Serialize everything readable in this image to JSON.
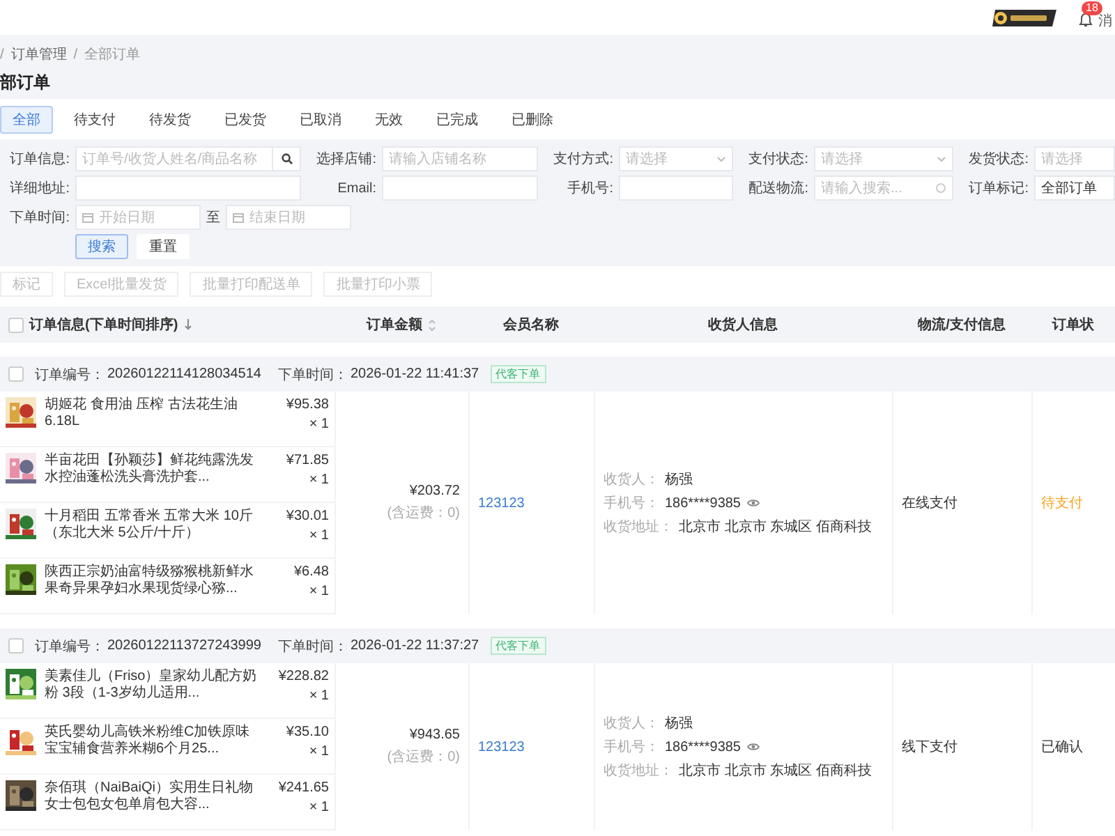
{
  "topbar": {
    "notification_count": "18",
    "notification_label": "消"
  },
  "breadcrumb": {
    "separator": "/",
    "items": [
      "订单管理",
      "全部订单"
    ]
  },
  "page_title": "部订单",
  "tabs": [
    {
      "label": "全部",
      "selected": true
    },
    {
      "label": "待支付",
      "selected": false
    },
    {
      "label": "待发货",
      "selected": false
    },
    {
      "label": "已发货",
      "selected": false
    },
    {
      "label": "已取消",
      "selected": false
    },
    {
      "label": "无效",
      "selected": false
    },
    {
      "label": "已完成",
      "selected": false
    },
    {
      "label": "已删除",
      "selected": false
    }
  ],
  "filter_rows": [
    [
      {
        "label": "订单信息:",
        "kind": "search",
        "placeholder": "订单号/收货人姓名/商品名称"
      },
      {
        "label": "选择店铺:",
        "kind": "text",
        "placeholder": "请输入店铺名称"
      },
      {
        "label": "支付方式:",
        "kind": "select",
        "placeholder": "请选择"
      },
      {
        "label": "支付状态:",
        "kind": "select",
        "placeholder": "请选择"
      },
      {
        "label": "发货状态:",
        "kind": "text",
        "placeholder": "请选择"
      }
    ],
    [
      {
        "label": "详细地址:",
        "kind": "text"
      },
      {
        "label": "Email:",
        "kind": "text"
      },
      {
        "label": "手机号:",
        "kind": "text"
      },
      {
        "label": "配送物流:",
        "kind": "lookup",
        "placeholder": "请输入搜索..."
      },
      {
        "label": "订单标记:",
        "kind": "text",
        "value": "全部订单"
      }
    ],
    [
      {
        "label": "下单时间:",
        "kind": "daterange",
        "start_placeholder": "开始日期",
        "separator": "至",
        "end_placeholder": "结束日期"
      }
    ]
  ],
  "filter_buttons": [
    {
      "label": "搜索",
      "kind": "primary"
    },
    {
      "label": "重置",
      "kind": "default"
    }
  ],
  "actions": [
    {
      "label": "标记",
      "disabled": true
    },
    {
      "label": "Excel批量发货",
      "disabled": true
    },
    {
      "label": "批量打印配送单",
      "disabled": true
    },
    {
      "label": "批量打印小票",
      "disabled": true
    }
  ],
  "table": {
    "select_all": {
      "checked": false
    },
    "columns": [
      {
        "label": "订单信息(下单时间排序)",
        "kind": "sorted"
      },
      {
        "label": "订单金额",
        "kind": "sortable"
      },
      {
        "label": "会员名称",
        "kind": "plain"
      },
      {
        "label": "收货人信息",
        "kind": "plain"
      },
      {
        "label": "物流/支付信息",
        "kind": "plain"
      },
      {
        "label": "订单状",
        "kind": "plain"
      }
    ]
  },
  "orders": [
    {
      "checked": false,
      "number_label": "订单编号：",
      "number": "20260122114128034514",
      "time_label": "下单时间：",
      "time": "2026-01-22 11:41:37",
      "tag": "代客下单",
      "items": [
        {
          "name": "胡姬花 食用油 压榨 古法花生油6.18L",
          "price": "¥95.38",
          "qty": "× 1"
        },
        {
          "name": "半亩花田【孙颖莎】鲜花纯露洗发水控油蓬松洗头膏洗护套...",
          "price": "¥71.85",
          "qty": "× 1"
        },
        {
          "name": "十月稻田 五常香米 五常大米 10斤（东北大米 5公斤/十斤）",
          "price": "¥30.01",
          "qty": "× 1"
        },
        {
          "name": "陕西正宗奶油富特级猕猴桃新鲜水果奇异果孕妇水果现货绿心猕...",
          "price": "¥6.48",
          "qty": "× 1"
        }
      ],
      "total": "¥203.72",
      "shipping": "(含运费：0)",
      "member": "123123",
      "receiver": {
        "name_label": "收货人：",
        "name": "杨强",
        "phone_label": "手机号：",
        "phone": "186****9385",
        "address_label": "收货地址：",
        "address": "北京市 北京市 东城区 佰商科技"
      },
      "payment": "在线支付",
      "status": {
        "label": "待支付",
        "color": "#f5a623"
      }
    },
    {
      "checked": false,
      "number_label": "订单编号：",
      "number": "20260122113727243999",
      "time_label": "下单时间：",
      "time": "2026-01-22 11:37:27",
      "tag": "代客下单",
      "items": [
        {
          "name": "美素佳儿（Friso）皇家幼儿配方奶粉 3段（1-3岁幼儿适用...",
          "price": "¥228.82",
          "qty": "× 1"
        },
        {
          "name": "英氏婴幼儿高铁米粉维C加铁原味宝宝辅食营养米糊6个月25...",
          "price": "¥35.10",
          "qty": "× 1"
        },
        {
          "name": "奈佰琪（NaiBaiQi）实用生日礼物女士包包女包单肩包大容...",
          "price": "¥241.65",
          "qty": "× 1"
        }
      ],
      "total": "¥943.65",
      "shipping": "(含运费：0)",
      "member": "123123",
      "receiver": {
        "name_label": "收货人：",
        "name": "杨强",
        "phone_label": "手机号：",
        "phone": "186****9385",
        "address_label": "收货地址：",
        "address": "北京市 北京市 东城区 佰商科技"
      },
      "payment": "线下支付",
      "status": {
        "label": "已确认",
        "color": "#333333"
      }
    }
  ]
}
